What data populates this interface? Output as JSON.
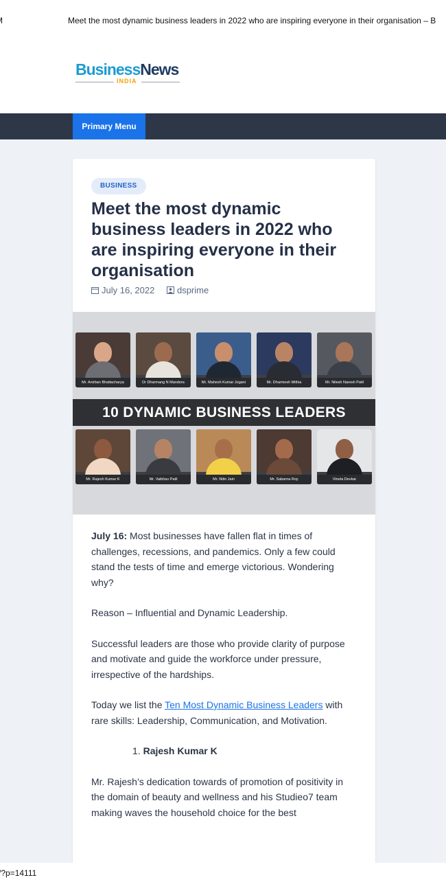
{
  "topbar": {
    "left_fragment": "M",
    "title_fragment": "Meet the most dynamic business leaders in 2022 who are inspiring everyone in their organisation – B"
  },
  "logo": {
    "part1": "Business",
    "part2": "News",
    "sub": "INDIA"
  },
  "nav": {
    "menu_label": "Primary Menu"
  },
  "post": {
    "category": "BUSINESS",
    "title": "Meet the most dynamic business leaders in 2022 who are inspiring everyone in their organisation",
    "date": "July 16, 2022",
    "author": "dsprime",
    "image": {
      "banner": "10 DYNAMIC BUSINESS LEADERS",
      "leaders_top": [
        "Mr. Anirban Bhattacharya",
        "Dr Dharmang N Mandora",
        "Mr. Mahesh Kumar Jogani",
        "Mr. Dharmesh Mithia",
        "Mr. Nilesh Naresh Patil"
      ],
      "leaders_bottom": [
        "Mr. Rajesh Kumar K",
        "Mr. Vaibhav Patil",
        "Mr. Nitin Jain",
        "Mr. Sabarna Roy",
        "Vineta Devkar"
      ]
    },
    "p1_bold": "July 16:",
    "p1_rest": " Most businesses have fallen flat in times of challenges, recessions, and pandemics. Only a few could stand the tests of time and emerge victorious. Wondering why?",
    "p2": "Reason – Influential and Dynamic Leadership.",
    "p3": "Successful leaders are those who provide clarity of purpose and motivate and guide the workforce under pressure, irrespective of the hardships.",
    "p4_pre": "Today we list the ",
    "p4_link": "Ten Most Dynamic Business Leaders",
    "p4_post": " with rare skills: Leadership, Communication, and Motivation.",
    "list_num": "1.",
    "list_item": "Rajesh Kumar K",
    "p5": "Mr. Rajesh’s dedication towards of promotion of positivity in the domain of beauty and wellness and his Studieo7 team making waves the household choice for the best"
  },
  "status": {
    "url_fragment": "/?p=14111"
  }
}
